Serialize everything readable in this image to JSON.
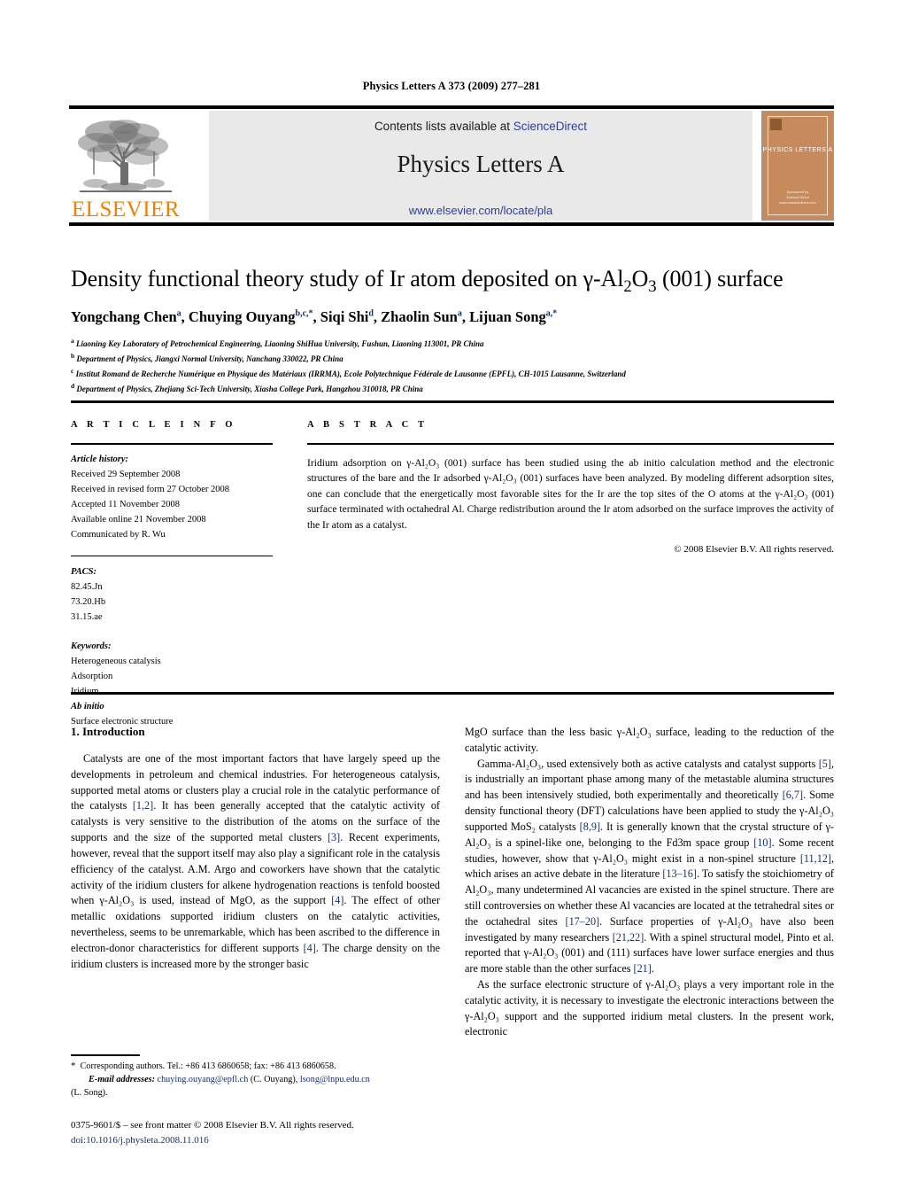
{
  "running_head": "Physics Letters A 373 (2009) 277–281",
  "masthead": {
    "contents_prefix": "Contents lists available at ",
    "sciencedirect": "ScienceDirect",
    "journal_title": "Physics Letters A",
    "journal_url": "www.elsevier.com/locate/pla",
    "publisher_wordmark": "ELSEVIER",
    "cover_title": "PHYSICS LETTERS A",
    "cover_footer": "Sponsored by\nScience Direct\nwww.sciencedirect.com",
    "accent_orange": "#f08000",
    "link_blue": "#2d3d99"
  },
  "title_parts": {
    "p1": "Density functional theory study of Ir atom deposited on ",
    "gamma": "γ",
    "p2": "-Al",
    "sub1": "2",
    "p3": "O",
    "sub2": "3",
    "p4": " (001) surface"
  },
  "authors": [
    {
      "name": "Yongchang Chen",
      "marks": "a",
      "sep": ", "
    },
    {
      "name": "Chuying Ouyang",
      "marks": "b,c,*",
      "sep": ", "
    },
    {
      "name": "Siqi Shi",
      "marks": "d",
      "sep": ", "
    },
    {
      "name": "Zhaolin Sun",
      "marks": "a",
      "sep": ", "
    },
    {
      "name": "Lijuan Song",
      "marks": "a,*",
      "sep": ""
    }
  ],
  "affiliations": [
    {
      "mark": "a",
      "text": "Liaoning Key Laboratory of Petrochemical Engineering, Liaoning ShiHua University, Fushun, Liaoning 113001, PR China"
    },
    {
      "mark": "b",
      "text": "Department of Physics, Jiangxi Normal University, Nanchang 330022, PR China"
    },
    {
      "mark": "c",
      "text": "Institut Romand de Recherche Numérique en Physique des Matériaux (IRRMA), Ecole Polytechnique Fédérale de Lausanne (EPFL), CH-1015 Lausanne, Switzerland"
    },
    {
      "mark": "d",
      "text": "Department of Physics, Zhejiang Sci-Tech University, Xiasha College Park, Hangzhou 310018, PR China"
    }
  ],
  "article_info": {
    "heading": "A R T I C L E    I N F O",
    "history_label": "Article history:",
    "history": [
      "Received 29 September 2008",
      "Received in revised form 27 October 2008",
      "Accepted 11 November 2008",
      "Available online 21 November 2008",
      "Communicated by R. Wu"
    ],
    "pacs_label": "PACS:",
    "pacs": [
      "82.45.Jn",
      "73.20.Hb",
      "31.15.ae"
    ],
    "keywords_label": "Keywords:",
    "keywords": [
      {
        "text": "Heterogeneous catalysis",
        "italic": false
      },
      {
        "text": "Adsorption",
        "italic": false
      },
      {
        "text": "Iridium",
        "italic": false
      },
      {
        "text": "Ab initio",
        "italic": true
      },
      {
        "text": "Surface electronic structure",
        "italic": false
      }
    ]
  },
  "abstract": {
    "heading": "A B S T R A C T",
    "body": "Iridium adsorption on γ-Al₂O₃ (001) surface has been studied using the ab initio calculation method and the electronic structures of the bare and the Ir adsorbed γ-Al₂O₃ (001) surfaces have been analyzed. By modeling different adsorption sites, one can conclude that the energetically most favorable sites for the Ir are the top sites of the O atoms at the γ-Al₂O₃ (001) surface terminated with octahedral Al. Charge redistribution around the Ir atom adsorbed on the surface improves the activity of the Ir atom as a catalyst.",
    "copyright": "© 2008 Elsevier B.V. All rights reserved."
  },
  "body": {
    "section_number_title": "1. Introduction",
    "left_paragraphs": [
      "Catalysts are one of the most important factors that have largely speed up the developments in petroleum and chemical industries. For heterogeneous catalysis, supported metal atoms or clusters play a crucial role in the catalytic performance of the catalysts [1,2]. It has been generally accepted that the catalytic activity of catalysts is very sensitive to the distribution of the atoms on the surface of the supports and the size of the supported metal clusters [3]. Recent experiments, however, reveal that the support itself may also play a significant role in the catalysis efficiency of the catalyst. A.M. Argo and coworkers have shown that the catalytic activity of the iridium clusters for alkene hydrogenation reactions is tenfold boosted when γ-Al₂O₃ is used, instead of MgO, as the support [4]. The effect of other metallic oxidations supported iridium clusters on the catalytic activities, nevertheless, seems to be unremarkable, which has been ascribed to the difference in electron-donor characteristics for different supports [4]. The charge density on the iridium clusters is increased more by the stronger basic"
    ],
    "right_paragraphs": [
      "MgO surface than the less basic γ-Al₂O₃ surface, leading to the reduction of the catalytic activity.",
      "Gamma-Al₂O₃, used extensively both as active catalysts and catalyst supports [5], is industrially an important phase among many of the metastable alumina structures and has been intensively studied, both experimentally and theoretically [6,7]. Some density functional theory (DFT) calculations have been applied to study the γ-Al₂O₃ supported MoS₂ catalysts [8,9]. It is generally known that the crystal structure of γ-Al₂O₃ is a spinel-like one, belonging to the Fd3m space group [10]. Some recent studies, however, show that γ-Al₂O₃ might exist in a non-spinel structure [11,12], which arises an active debate in the literature [13–16]. To satisfy the stoichiometry of Al₂O₃, many undetermined Al vacancies are existed in the spinel structure. There are still controversies on whether these Al vacancies are located at the tetrahedral sites or the octahedral sites [17–20]. Surface properties of γ-Al₂O₃ have also been investigated by many researchers [21,22]. With a spinel structural model, Pinto et al. reported that γ-Al₂O₃ (001) and (111) surfaces have lower surface energies and thus are more stable than the other surfaces [21].",
      "As the surface electronic structure of γ-Al₂O₃ plays a very important role in the catalytic activity, it is necessary to investigate the electronic interactions between the γ-Al₂O₃ support and the supported iridium metal clusters. In the present work, electronic"
    ]
  },
  "footnotes": {
    "star": "*",
    "corresponding": "Corresponding authors. Tel.: +86 413 6860658; fax: +86 413 6860658.",
    "email_label": "E-mail addresses:",
    "email1": "chuying.ouyang@epfl.ch",
    "email1_owner": "(C. Ouyang),",
    "email2": "lsong@lnpu.edu.cn",
    "email2_owner": "(L. Song)."
  },
  "imprint": {
    "issn_line": "0375-9601/$ – see front matter  © 2008 Elsevier B.V. All rights reserved.",
    "doi": "doi:10.1016/j.physleta.2008.11.016"
  }
}
